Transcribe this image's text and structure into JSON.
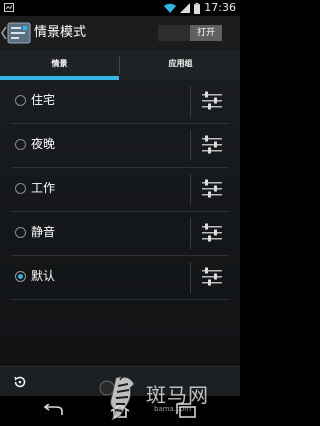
{
  "status_bar": {
    "time": "17:36"
  },
  "action_bar": {
    "title": "情景模式",
    "toggle_on_label": "打开"
  },
  "tabs": [
    {
      "label": "情景",
      "selected": true
    },
    {
      "label": "应用组",
      "selected": false
    }
  ],
  "profiles": [
    {
      "label": "住宅",
      "selected": false
    },
    {
      "label": "夜晚",
      "selected": false
    },
    {
      "label": "工作",
      "selected": false
    },
    {
      "label": "静音",
      "selected": false
    },
    {
      "label": "默认",
      "selected": true
    }
  ],
  "colors": {
    "accent": "#33b5e5",
    "background": "#15181b"
  },
  "watermark": {
    "text": "斑马网",
    "sub": "bama.com"
  }
}
